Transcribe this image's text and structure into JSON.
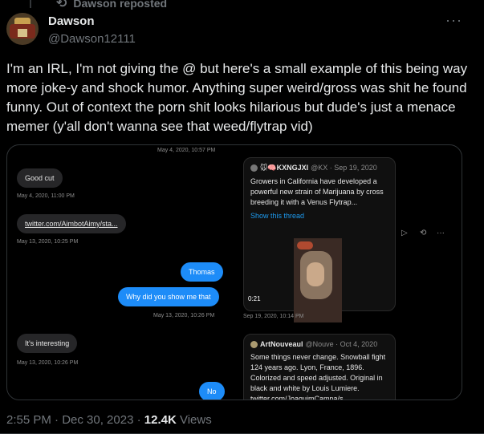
{
  "repost": {
    "label": "Dawson reposted"
  },
  "author": {
    "name": "Dawson",
    "handle": "@Dawson12111"
  },
  "more_label": "···",
  "tweet": {
    "text": "I'm an IRL, I'm not giving the @ but here's a small example of this being way more joke-y and shock humor. Anything super weird/gross was shit he found funny. Out of context the porn shit looks hilarious but dude's just a menace memer (y'all don't wanna see that weed/flytrap vid)"
  },
  "screenshot": {
    "top_timestamp": "May 4, 2020, 10:57 PM",
    "messages": [
      {
        "text": "Good cut",
        "time": "May 4, 2020, 11:00 PM"
      },
      {
        "text": "twitter.com/AimbotAimy/sta...",
        "time": "May 13, 2020, 10:25 PM"
      },
      {
        "text": "Thomas"
      },
      {
        "text": "Why did you show me that",
        "time": "May 13, 2020, 10:26 PM"
      },
      {
        "text": "It's interesting",
        "time": "May 13, 2020, 10:26 PM"
      },
      {
        "text": "No"
      }
    ],
    "card1": {
      "user": "🐭🧠KXNGJXI",
      "meta": "@KX · Sep 19, 2020",
      "text": "Growers in California have developed a powerful new strain of Marijuana by cross breeding it with a Venus Flytrap...",
      "show_thread": "Show this thread",
      "duration": "0:21",
      "time": "Sep 19, 2020, 10:14 PM"
    },
    "card2": {
      "user": "ArtNouveaul",
      "meta": "@Nouve · Oct 4, 2020",
      "text": "Some things never change. Snowball fight 124 years ago. Lyon, France, 1896. Colorized and speed adjusted. Original in black and white by Louis Lumiere. twitter.com/JoaquimCampa/s..."
    },
    "actions": {
      "play": "▷",
      "retweet": "⟲",
      "more": "···"
    }
  },
  "footer": {
    "time": "2:55 PM · Dec 30, 2023 · ",
    "views_count": "12.4K",
    "views_label": " Views"
  }
}
